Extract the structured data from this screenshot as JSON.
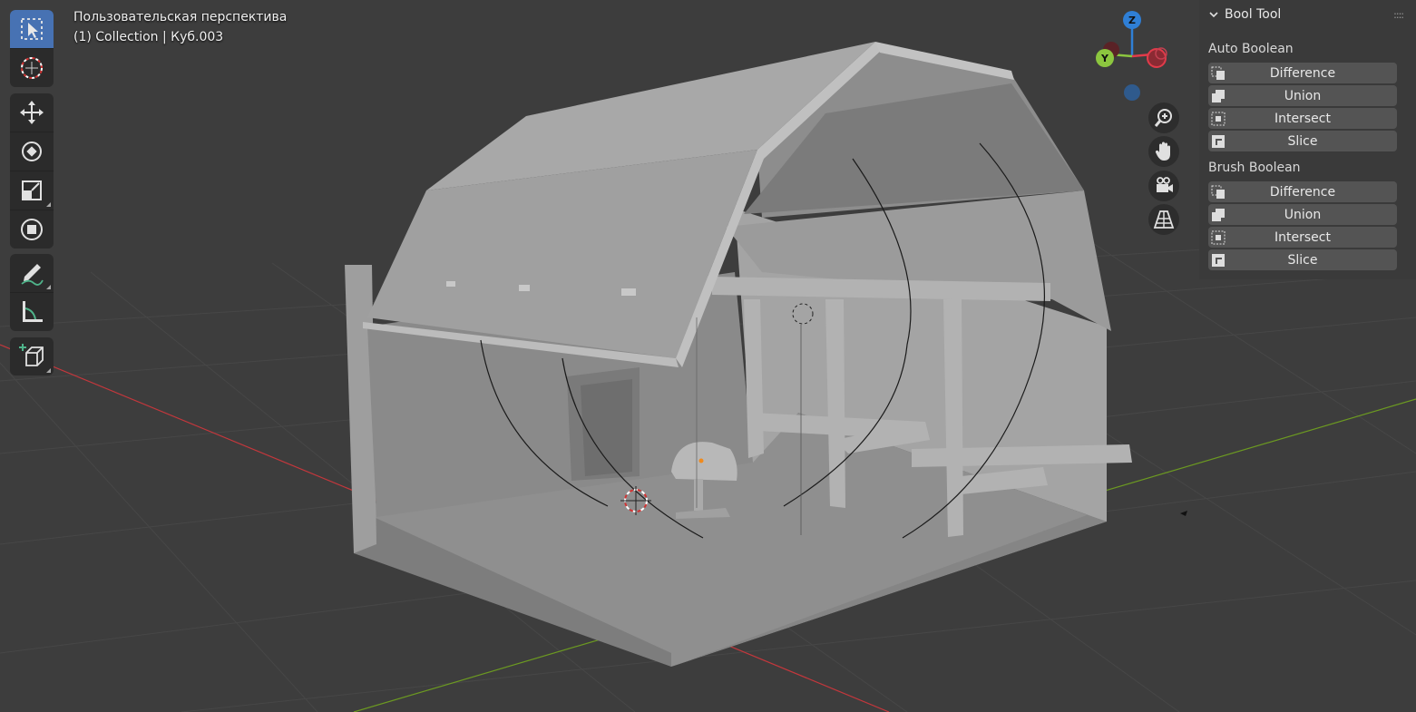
{
  "viewport": {
    "view_name": "Пользовательская перспектива",
    "collection_info": "(1) Collection | Куб.003",
    "background_color": "#3d3d3d",
    "x_axis_color": "#c4373c",
    "y_axis_color": "#6c9a21"
  },
  "toolbar": {
    "tools": [
      {
        "name": "select-box",
        "icon": "cursor-box-icon",
        "active": true
      },
      {
        "name": "cursor",
        "icon": "crosshair-cursor-icon"
      },
      {
        "name": "move",
        "icon": "move-arrows-icon"
      },
      {
        "name": "rotate",
        "icon": "rotate-icon"
      },
      {
        "name": "scale",
        "icon": "scale-icon"
      },
      {
        "name": "transform",
        "icon": "transform-icon"
      },
      {
        "name": "annotate",
        "icon": "annotate-pencil-icon"
      },
      {
        "name": "measure",
        "icon": "measure-ruler-icon"
      },
      {
        "name": "add-cube",
        "icon": "add-cube-icon"
      }
    ],
    "active_color": "#4772b3"
  },
  "gizmo": {
    "z_label": "Z",
    "y_label": "Y",
    "x_color": "#e23b4a",
    "y_color": "#8cc63f",
    "z_color": "#2f7fd6"
  },
  "nav_buttons": [
    "zoom-icon",
    "hand-pan-icon",
    "camera-icon",
    "grid-perspective-icon"
  ],
  "sidebar": {
    "panel_title": "Bool Tool",
    "drag_handle": "::::",
    "sections": [
      {
        "label": "Auto Boolean",
        "buttons": [
          {
            "label": "Difference",
            "icon": "boolean-difference-icon"
          },
          {
            "label": "Union",
            "icon": "boolean-union-icon"
          },
          {
            "label": "Intersect",
            "icon": "boolean-intersect-icon"
          },
          {
            "label": "Slice",
            "icon": "boolean-slice-icon"
          }
        ]
      },
      {
        "label": "Brush Boolean",
        "buttons": [
          {
            "label": "Difference",
            "icon": "boolean-difference-icon"
          },
          {
            "label": "Union",
            "icon": "boolean-union-icon"
          },
          {
            "label": "Intersect",
            "icon": "boolean-intersect-icon"
          },
          {
            "label": "Slice",
            "icon": "boolean-slice-icon"
          }
        ]
      }
    ]
  }
}
